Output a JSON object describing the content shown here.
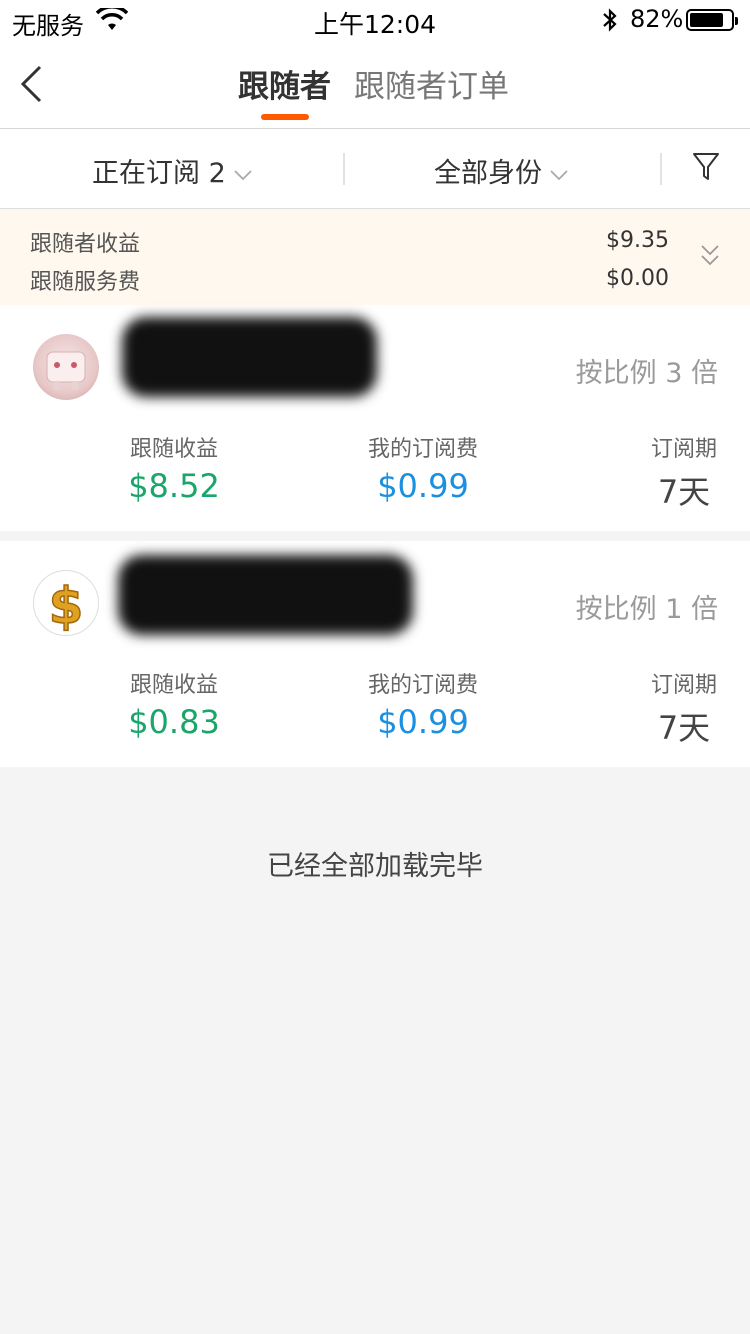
{
  "status_bar": {
    "carrier": "无服务",
    "time": "上午12:04",
    "battery": "82%",
    "battery_level": 0.82
  },
  "nav": {
    "tabs": [
      {
        "label": "跟随者",
        "active": true
      },
      {
        "label": "跟随者订单",
        "active": false
      }
    ],
    "accent_color": "#ff5a00"
  },
  "filters": {
    "subscription": "正在订阅 2",
    "identity": "全部身份"
  },
  "summary": {
    "income_label": "跟随者收益",
    "income_value": "$9.35",
    "fee_label": "跟随服务费",
    "fee_value": "$0.00"
  },
  "followers": [
    {
      "avatar": "pink-robot-avatar",
      "ratio": "按比例 3 倍",
      "income_label": "跟随收益",
      "income_value": "$8.52",
      "fee_label": "我的订阅费",
      "fee_value": "$0.99",
      "period_label": "订阅期",
      "period_value": "7天"
    },
    {
      "avatar": "gold-dollar-avatar",
      "ratio": "按比例 1 倍",
      "income_label": "跟随收益",
      "income_value": "$0.83",
      "fee_label": "我的订阅费",
      "fee_value": "$0.99",
      "period_label": "订阅期",
      "period_value": "7天"
    }
  ],
  "end_message": "已经全部加载完毕",
  "colors": {
    "green": "#1aa56a",
    "blue": "#1b8fe0",
    "summary_bg": "#fff8ee"
  }
}
